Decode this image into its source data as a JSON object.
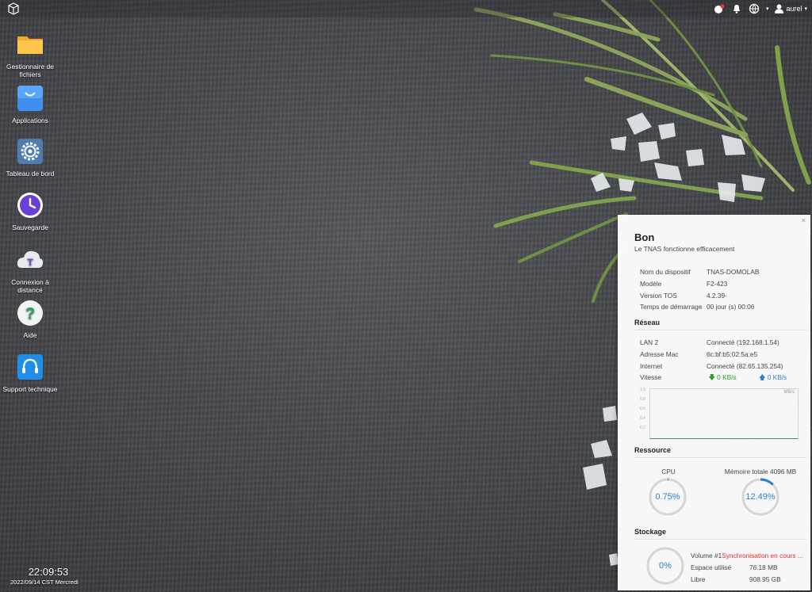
{
  "topbar": {
    "user": "aurel",
    "icons": [
      "notification-icon",
      "bell-icon",
      "globe-icon",
      "user-icon"
    ]
  },
  "desktop": {
    "icons": [
      {
        "label": "Gestionnaire de fichiers",
        "icon": "folder-icon"
      },
      {
        "label": "Applications",
        "icon": "shopping-bag-icon"
      },
      {
        "label": "Tableau de bord",
        "icon": "gear-icon"
      },
      {
        "label": "Sauvegarde",
        "icon": "clock-icon"
      },
      {
        "label": "Connexion à distance",
        "icon": "cloud-icon"
      },
      {
        "label": "Aide",
        "icon": "help-icon"
      },
      {
        "label": "Support technique",
        "icon": "headset-icon"
      }
    ]
  },
  "clock": {
    "time": "22:09:53",
    "date": "2022/09/14 CST Mercredi"
  },
  "panel": {
    "close": "×",
    "title": "Bon",
    "subtitle": "Le TNAS fonctionne efficacement",
    "device": [
      {
        "label": "Nom du dispositif",
        "value": "TNAS-DOMOLAB"
      },
      {
        "label": "Modèle",
        "value": "F2-423"
      },
      {
        "label": "Version TOS",
        "value": "4.2.39-"
      },
      {
        "label": "Temps de démarrage",
        "value": "00 jour (s) 00:06"
      }
    ],
    "network": {
      "title": "Réseau",
      "rows": [
        {
          "label": "LAN 2",
          "value": "Connecté (192.168.1.54)"
        },
        {
          "label": "Adresse Mac",
          "value": "6c:bf:b5:02:5a:e5"
        },
        {
          "label": "Internet",
          "value": "Connecté (82.65.135.254)"
        }
      ],
      "speed_label": "Vitesse",
      "download": "0 KB/s",
      "upload": "0 KB/s",
      "chart_unit": "MB/s",
      "chart_ticks": [
        "1.0",
        "0.8",
        "0.6",
        "0.4",
        "0.2"
      ]
    },
    "resource": {
      "title": "Ressource",
      "cpu_label": "CPU",
      "cpu_value": "0.75%",
      "cpu_fraction": 0.0075,
      "mem_label": "Mémoire totale 4096 MB",
      "mem_value": "12.49%",
      "mem_fraction": 0.1249
    },
    "storage": {
      "title": "Stockage",
      "gauge_value": "0%",
      "volume_label": "Volume #1",
      "volume_status": "Synchronisation en cours ...",
      "used_label": "Espace utilisé",
      "used_value": "76.18 MB",
      "free_label": "Libre",
      "free_value": "908.95 GB"
    }
  },
  "colors": {
    "accent": "#2c7fcf",
    "warning": "#d93030",
    "download": "#2a9d2a"
  }
}
